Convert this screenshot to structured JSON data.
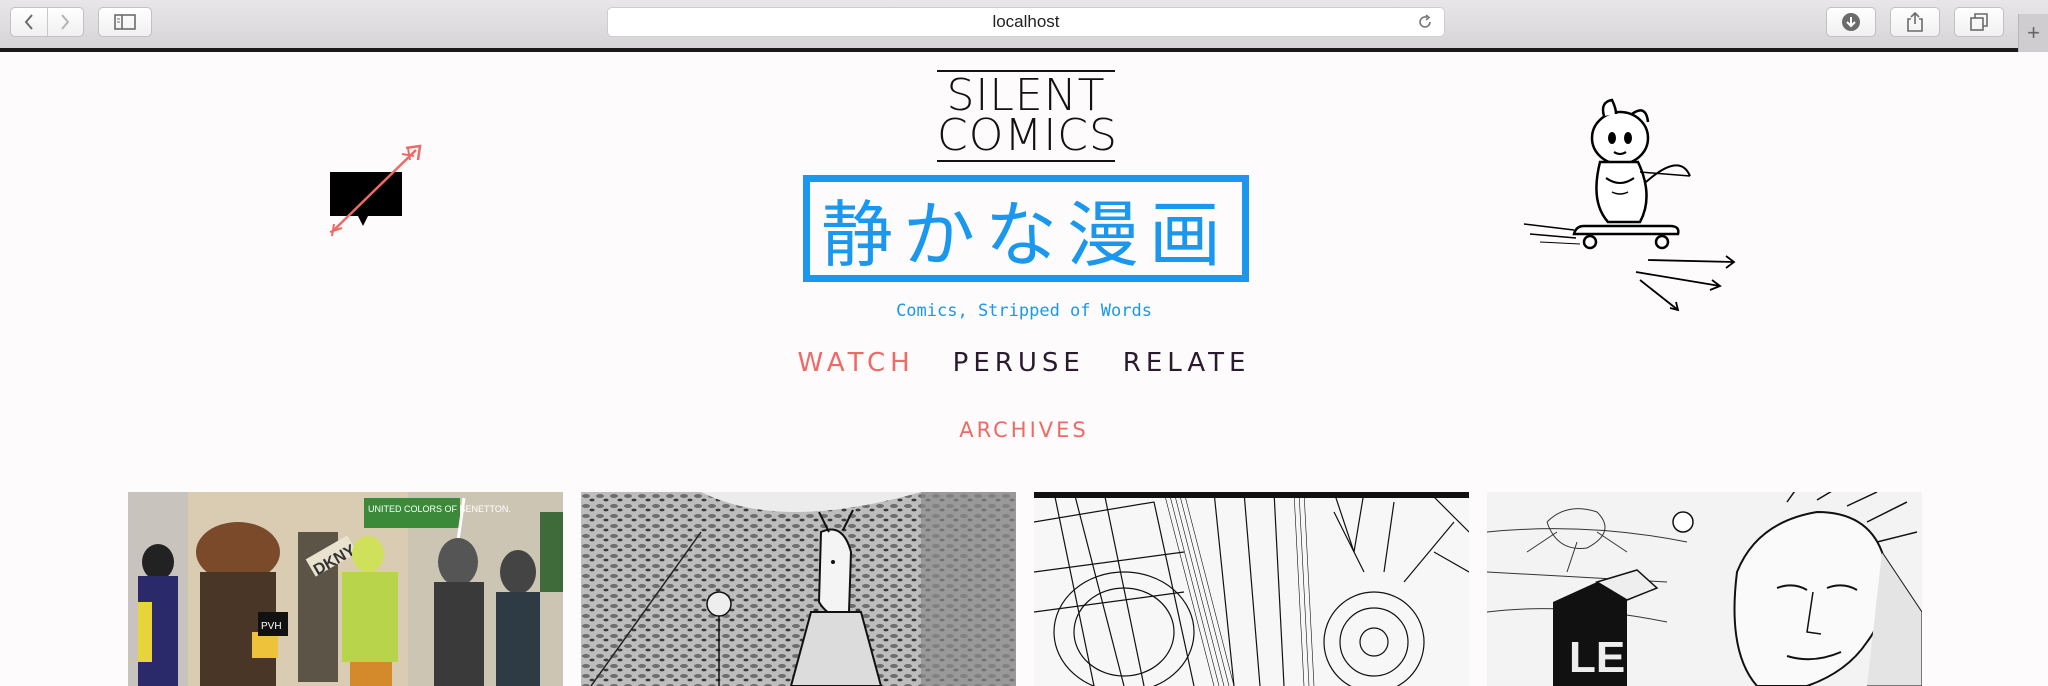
{
  "browser": {
    "url": "localhost",
    "back_icon": "chevron-left-icon",
    "forward_icon": "chevron-right-icon",
    "sidebar_icon": "sidebar-icon",
    "reload_icon": "reload-icon",
    "download_icon": "download-icon",
    "share_icon": "share-icon",
    "tabs_icon": "tabs-icon",
    "newtab_label": "+"
  },
  "site": {
    "logo_line1": "SILENT",
    "logo_line2": "COMICS",
    "logo_jp": "静かな漫画",
    "tagline": "Comics, Stripped of Words",
    "accent_blue": "#1a97ee",
    "accent_coral": "#ee6a66"
  },
  "nav": {
    "items": [
      {
        "label": "WATCH",
        "active": true
      },
      {
        "label": "PERUSE",
        "active": false
      },
      {
        "label": "RELATE",
        "active": false
      }
    ],
    "archives": "ARCHIVES"
  },
  "gallery": {
    "items": [
      {
        "label": "UNITED COLORS OF BENETTON.",
        "sign2": "DKNY",
        "sign3": "PVH",
        "kind": "color-protest"
      },
      {
        "kind": "bw-field-deer"
      },
      {
        "kind": "bw-machinery"
      },
      {
        "label": "LE",
        "kind": "bw-portrait"
      }
    ]
  }
}
